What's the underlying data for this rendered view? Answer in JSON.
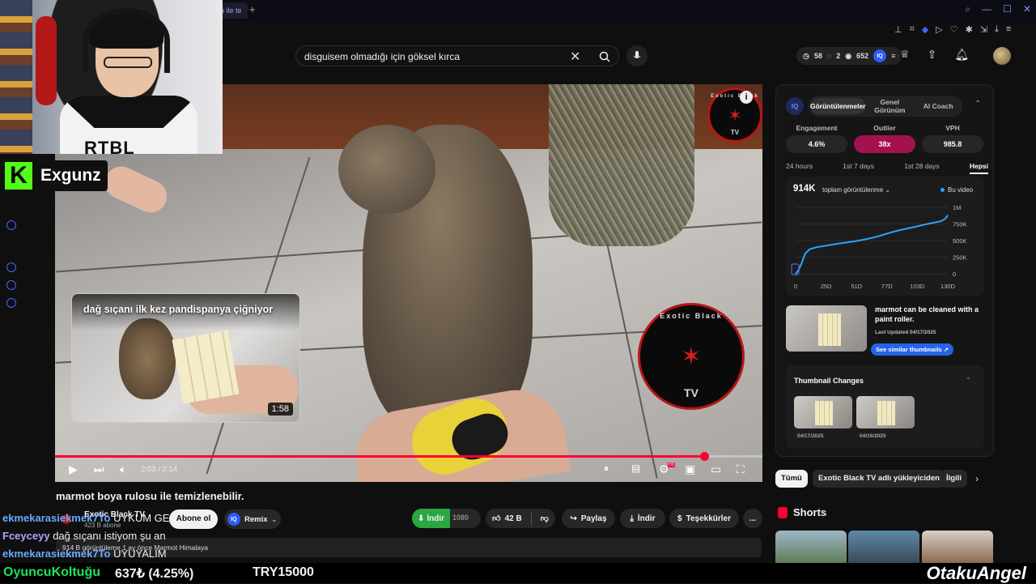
{
  "browser": {
    "active_tab_label": "u ile te",
    "new_tab_symbol": "+"
  },
  "stream": {
    "kick_logo_letter": "K",
    "streamer_name": "Exgunz",
    "webcam_shirt_text": "RTBL"
  },
  "search": {
    "query": "disguisem olmadığı için göksel kırca"
  },
  "header": {
    "stat_1": "58",
    "stat_2": "2",
    "stat_3": "652"
  },
  "video": {
    "end_card_title": "dağ sıçanı ilk kez pandispanya çiğniyor",
    "end_card_duration": "1:58",
    "time_display": "2:03 / 2:14",
    "progress_fraction": 0.918,
    "hd_badge": "HD",
    "watermark_text": "Exotic Black",
    "watermark_tv": "TV"
  },
  "below_video": {
    "title": "marmot boya rulosu ile temizlenebilir.",
    "channel_name": "Exotic Black TV",
    "subscriber_count": "423 B abone",
    "subscribe_label": "Abone ol",
    "remix_label": "Remix",
    "indir_green_label": "İndir",
    "quality_label": "1080",
    "like_count": "42 B",
    "share_label": "Paylaş",
    "download_label": "İndir",
    "thanks_label": "Teşekkürler",
    "more_label": "...",
    "description_meta": "914 B görüntüleme  1 ay önce  Marmot Himalaya"
  },
  "chat": [
    {
      "user": "ekmekarasiekmek7To",
      "message": "UYKUM GE"
    },
    {
      "user": "Fceyceyy",
      "message": "dağ sıçanı istiyom şu an"
    },
    {
      "user": "ekmekarasiekmek7To",
      "message": "UYUYALIM"
    }
  ],
  "ticker": {
    "item_name": "OyuncuKoltuğu",
    "price": "637₺ (4.25%)",
    "target": "TRY15000",
    "brand": "OtakuAngel"
  },
  "panel": {
    "logo": "IQ",
    "tabs": [
      "Görüntülenmeler",
      "Genel Görünüm",
      "AI Coach"
    ],
    "metrics": [
      {
        "label": "Engagement",
        "value": "4.6%",
        "highlight": false
      },
      {
        "label": "Outlier",
        "value": "38x",
        "highlight": true
      },
      {
        "label": "VPH",
        "value": "985.8",
        "highlight": false
      }
    ],
    "highlight_color": "#a3124f",
    "ranges": [
      "24 hours",
      "1st 7 days",
      "1st 28 days",
      "Hepsi"
    ],
    "total_views": "914K",
    "total_label": "toplam görüntülenme",
    "legend_label": "Bu video",
    "similar_title": "marmot can be cleaned with a paint roller.",
    "similar_updated": "Last Updated 04/17/2025",
    "similar_button": "See similar thumbnails",
    "thumb_changes_title": "Thumbnail Changes",
    "thumb_dates": [
      "04/17/2025",
      "04/16/2025"
    ]
  },
  "chart_data": {
    "type": "line",
    "title": "",
    "xlabel": "",
    "ylabel": "",
    "x_ticks": [
      "0",
      "25D",
      "51D",
      "77D",
      "103D",
      "130D"
    ],
    "y_ticks": [
      "0",
      "250K",
      "500K",
      "750K",
      "1M"
    ],
    "ylim": [
      0,
      1000000
    ],
    "xlim": [
      0,
      130
    ],
    "series": [
      {
        "name": "Bu video",
        "color": "#2aa4ff",
        "x": [
          0,
          2,
          5,
          8,
          12,
          18,
          25,
          35,
          45,
          51,
          60,
          70,
          77,
          85,
          95,
          103,
          110,
          118,
          124,
          128,
          130
        ],
        "y": [
          0,
          40000,
          150000,
          300000,
          370000,
          400000,
          420000,
          450000,
          475000,
          490000,
          520000,
          560000,
          600000,
          640000,
          680000,
          710000,
          740000,
          770000,
          790000,
          830000,
          880000
        ]
      }
    ]
  },
  "filters": [
    "Tümü",
    "Exotic Black TV adlı yükleyiciden",
    "İlgili"
  ],
  "shorts_title": "Shorts"
}
